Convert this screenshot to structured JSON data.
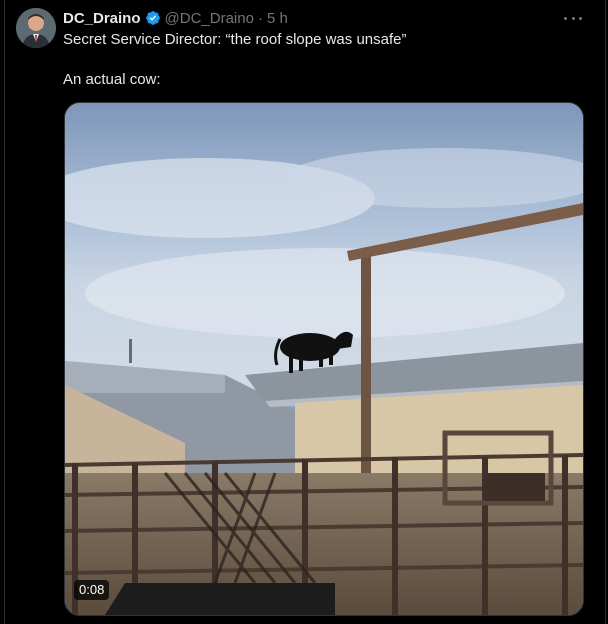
{
  "tweet": {
    "display_name": "DC_Draino",
    "handle": "@DC_Draino",
    "separator": "·",
    "time": "5 h",
    "lines": [
      "Secret Service Director: “the roof slope was unsafe”",
      "An actual cow:"
    ],
    "verified_icon": "verified-badge-icon",
    "more_icon": "more-options-icon"
  },
  "media": {
    "duration": "0:08"
  },
  "colors": {
    "background": "#000000",
    "text": "#e7e9ea",
    "muted": "#71767b",
    "verified": "#1d9bf0"
  }
}
